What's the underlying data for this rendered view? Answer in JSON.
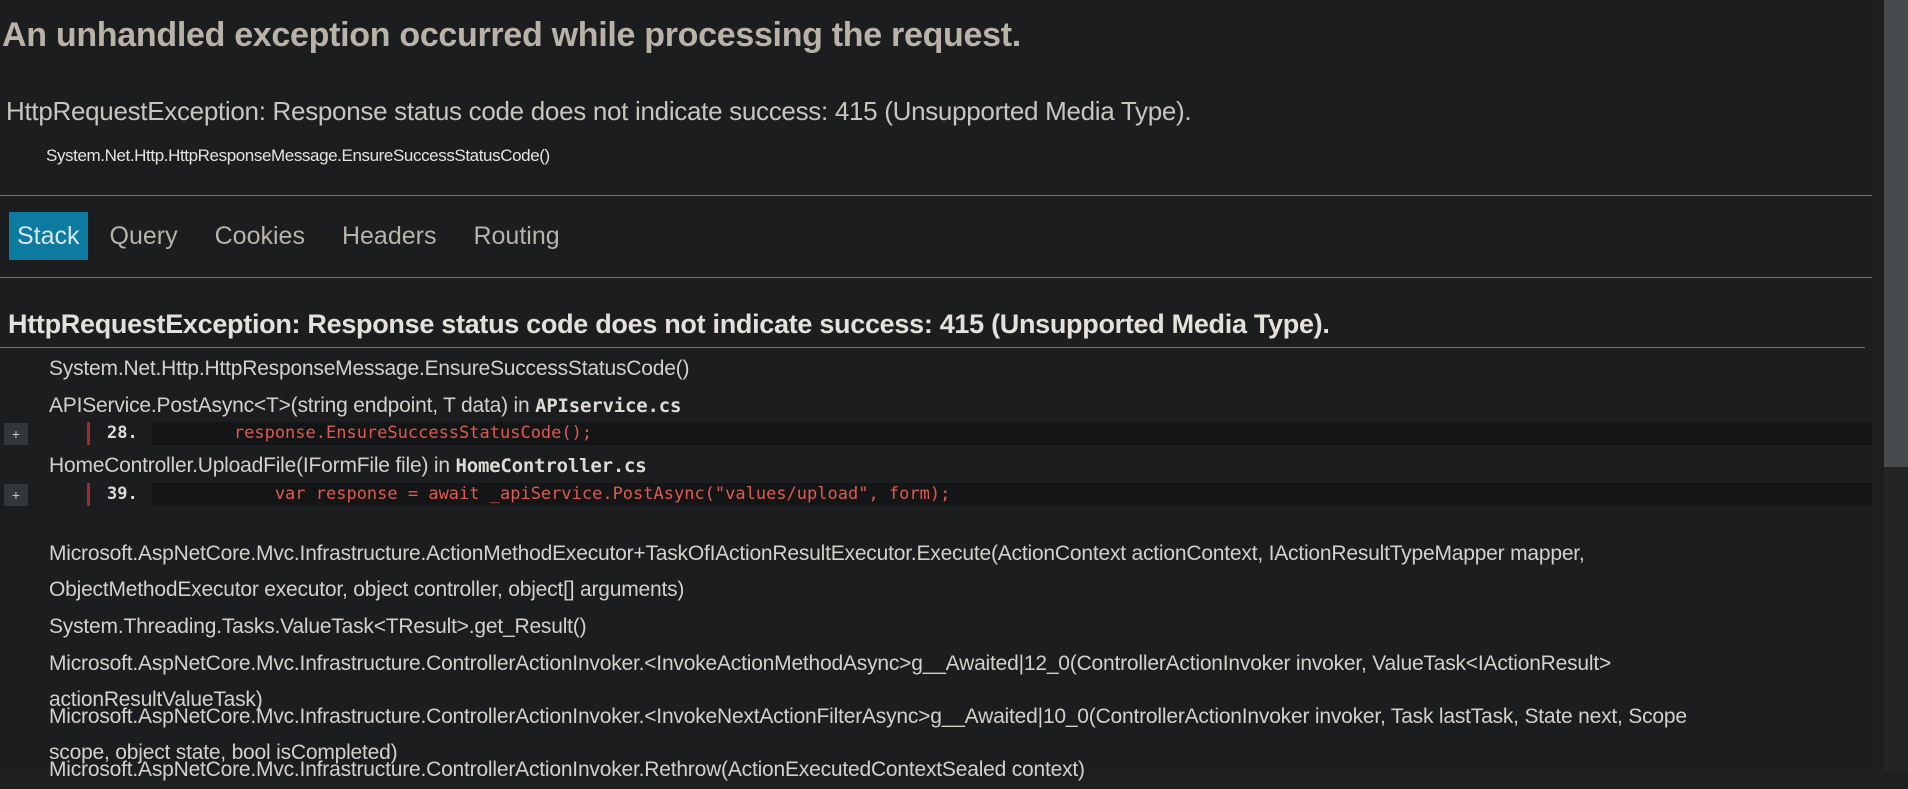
{
  "title": "An unhandled exception occurred while processing the request.",
  "exception_summary": "HttpRequestException: Response status code does not indicate success: 415 (Unsupported Media Type).",
  "exception_location": "System.Net.Http.HttpResponseMessage.EnsureSuccessStatusCode()",
  "tabs": [
    {
      "label": "Stack",
      "active": true
    },
    {
      "label": "Query"
    },
    {
      "label": "Cookies"
    },
    {
      "label": "Headers"
    },
    {
      "label": "Routing"
    }
  ],
  "stack": {
    "heading": "HttpRequestException: Response status code does not indicate success: 415 (Unsupported Media Type).",
    "frames": [
      {
        "text": "System.Net.Http.HttpResponseMessage.EnsureSuccessStatusCode()"
      },
      {
        "text": "APIService.PostAsync<T>(string endpoint, T data) in ",
        "file": "APIservice.cs",
        "code": {
          "expand": "+",
          "line": "28.",
          "source": "        response.EnsureSuccessStatusCode();"
        }
      },
      {
        "text": "HomeController.UploadFile(IFormFile file) in ",
        "file": "HomeController.cs",
        "code": {
          "expand": "+",
          "line": "39.",
          "source": "            var response = await _apiService.PostAsync(\"values/upload\", form);"
        }
      },
      {
        "text": "Microsoft.AspNetCore.Mvc.Infrastructure.ActionMethodExecutor+TaskOfIActionResultExecutor.Execute(ActionContext actionContext, IActionResultTypeMapper mapper,",
        "text2": "ObjectMethodExecutor executor, object controller, object[] arguments)"
      },
      {
        "text": "System.Threading.Tasks.ValueTask<TResult>.get_Result()"
      },
      {
        "text": "Microsoft.AspNetCore.Mvc.Infrastructure.ControllerActionInvoker.<InvokeActionMethodAsync>g__Awaited|12_0(ControllerActionInvoker invoker, ValueTask<IActionResult>",
        "text2": "actionResultValueTask)"
      },
      {
        "text": "Microsoft.AspNetCore.Mvc.Infrastructure.ControllerActionInvoker.<InvokeNextActionFilterAsync>g__Awaited|10_0(ControllerActionInvoker invoker, Task lastTask, State next, Scope",
        "text2": "scope, object state, bool isCompleted)"
      },
      {
        "text": "Microsoft.AspNetCore.Mvc.Infrastructure.ControllerActionInvoker.Rethrow(ActionExecutedContextSealed context)"
      }
    ]
  }
}
